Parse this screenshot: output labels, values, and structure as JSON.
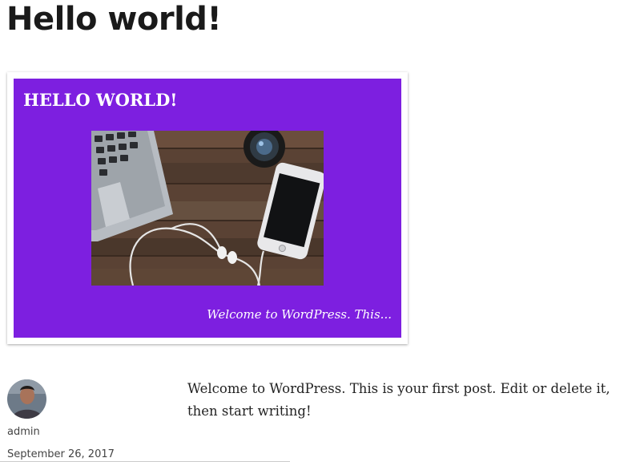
{
  "post": {
    "title": "Hello world!",
    "body": "Welcome to WordPress. This is your first post. Edit or delete it, then start writing!"
  },
  "featured_image": {
    "heading": "HELLO WORLD!",
    "excerpt": "Welcome to WordPress. This...",
    "background_color": "#7d1fe0"
  },
  "meta": {
    "author": "admin",
    "date": "September 26, 2017"
  }
}
